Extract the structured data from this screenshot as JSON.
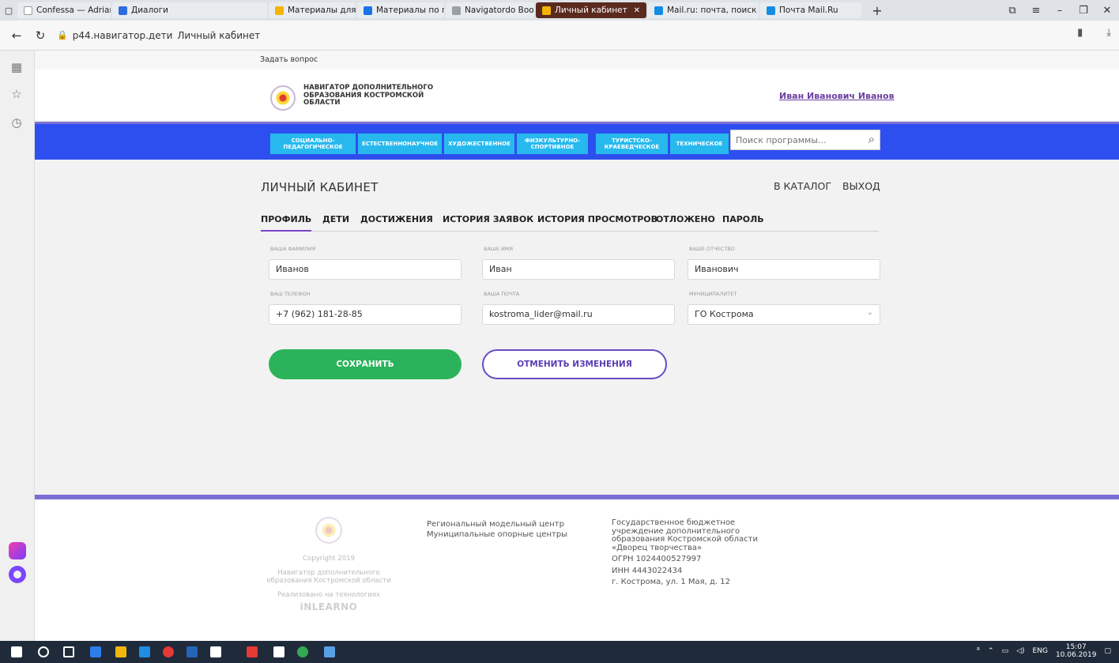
{
  "browser": {
    "tabs": [
      {
        "label": "Confessa — Adrian...",
        "icon": "play-icon",
        "color": "#ffffff",
        "close": "✕"
      },
      {
        "label": "Диалоги",
        "icon": "chat-icon",
        "color": "#2d6cdf"
      },
      {
        "label": "Материалы для проведе...",
        "icon": "pinwheel-icon",
        "color": "#f4b400"
      },
      {
        "label": "Материалы по проведени...",
        "icon": "arc-icon",
        "color": "#1a73e8"
      },
      {
        "label": "Navigatordo Booking",
        "icon": "figure-icon",
        "color": "#9aa0a6"
      },
      {
        "label": "Личный кабинет",
        "icon": "pinwheel-icon",
        "color": "#f4b400",
        "close": "✕"
      },
      {
        "label": "Mail.ru: почта, поиск в инт...",
        "icon": "mail-at-icon",
        "color": "#168de2"
      },
      {
        "label": "Почта Mail.Ru",
        "icon": "mail-at-icon",
        "color": "#168de2"
      }
    ],
    "new_tab": "+",
    "url_domain": "p44.навигатор.дети",
    "url_title": "Личный кабинет"
  },
  "site": {
    "ask_question": "Задать вопрос",
    "brand": "НАВИГАТОР ДОПОЛНИТЕЛЬНОГО ОБРАЗОВАНИЯ КОСТРОМСКОЙ ОБЛАСТИ",
    "user_name": "Иван Иванович Иванов",
    "categories": [
      "СОЦИАЛЬНО-ПЕДАГОГИЧЕСКОЕ",
      "ЕСТЕСТВЕННОНАУЧНОЕ",
      "ХУДОЖЕСТВЕННОЕ",
      "ФИЗКУЛЬТУРНО-СПОРТИВНОЕ",
      "ТУРИСТСКО-КРАЕВЕДЧЕСКОЕ",
      "ТЕХНИЧЕСКОЕ"
    ],
    "search_placeholder": "Поиск программы...",
    "page_title": "ЛИЧНЫЙ КАБИНЕТ",
    "to_catalog": "В КАТАЛОГ",
    "logout": "ВЫХОД",
    "profile_tabs": [
      "ПРОФИЛЬ",
      "ДЕТИ",
      "ДОСТИЖЕНИЯ",
      "ИСТОРИЯ ЗАЯВОК",
      "ИСТОРИЯ ПРОСМОТРОВ",
      "ОТЛОЖЕНО",
      "ПАРОЛЬ"
    ],
    "form": {
      "surname_label": "ВАША ФАМИЛИЯ",
      "surname": "Иванов",
      "name_label": "ВАШЕ ИМЯ",
      "name": "Иван",
      "patronymic_label": "ВАШЕ ОТЧЕСТВО",
      "patronymic": "Иванович",
      "phone_label": "ВАШ ТЕЛЕФОН",
      "phone": "+7 (962) 181-28-85",
      "email_label": "ВАША ПОЧТА",
      "email": "kostroma_lider@mail.ru",
      "municipality_label": "МУНИЦИПАЛИТЕТ",
      "municipality": "ГО Кострома"
    },
    "save": "СОХРАНИТЬ",
    "cancel": "ОТМЕНИТЬ ИЗМЕНЕНИЯ",
    "footer": {
      "copyright": "Copyright 2019",
      "navigator": "Навигатор дополнительного образования Костромской области",
      "implemented": "Реализовано на технологиях",
      "inlearno": "iNLEARNO",
      "regional_center": "Региональный модельный центр",
      "municipal_centers": "Муниципальные опорные центры",
      "org": "Государственное бюджетное учреждение дополнительного образования Костромской области «Дворец творчества»",
      "ogrn": "ОГРН 1024400527997",
      "inn": "ИНН 4443022434",
      "address": "г. Кострома, ул. 1 Мая, д. 12"
    }
  },
  "taskbar": {
    "lang": "ENG",
    "time": "15:07",
    "date": "10.06.2019"
  },
  "colors": {
    "nav_blue": "#2e4ff0",
    "category_cyan": "#27b9ee",
    "save_green": "#2ab35a",
    "accent_purple": "#6a4bc4"
  }
}
